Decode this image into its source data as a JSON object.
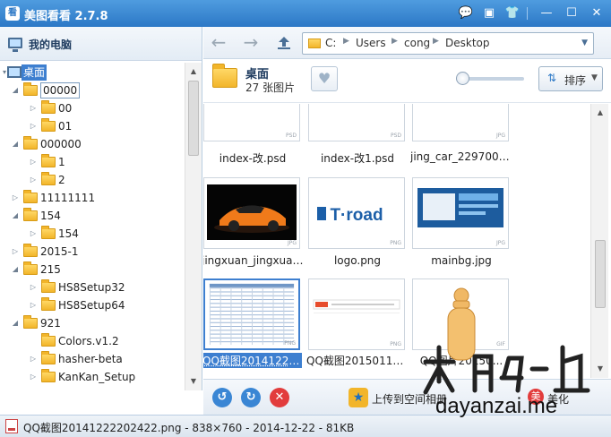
{
  "app": {
    "title": "美图看看 2.7.8",
    "icon_text": "看"
  },
  "titlebar_buttons": [
    {
      "name": "chat-icon",
      "glyph": "💬"
    },
    {
      "name": "menu-icon",
      "glyph": "▣"
    },
    {
      "name": "skin-icon",
      "glyph": "👕"
    },
    {
      "name": "minimize-icon",
      "glyph": "—"
    },
    {
      "name": "maximize-icon",
      "glyph": "☐"
    },
    {
      "name": "close-icon",
      "glyph": "✕"
    }
  ],
  "sidebar": {
    "root_label": "我的电脑",
    "tree": [
      {
        "label": "桌面",
        "depth": 0,
        "type": "desktop",
        "arrow": "▾",
        "selected": true
      },
      {
        "label": "00000",
        "depth": 1,
        "arrow": "◢",
        "boxed": true
      },
      {
        "label": "00",
        "depth": 2,
        "arrow": "▷"
      },
      {
        "label": "01",
        "depth": 2,
        "arrow": "▷"
      },
      {
        "label": "000000",
        "depth": 1,
        "arrow": "◢"
      },
      {
        "label": "1",
        "depth": 2,
        "arrow": "▷"
      },
      {
        "label": "2",
        "depth": 2,
        "arrow": "▷"
      },
      {
        "label": "11111111",
        "depth": 1,
        "arrow": "▷"
      },
      {
        "label": "154",
        "depth": 1,
        "arrow": "◢"
      },
      {
        "label": "154",
        "depth": 2,
        "arrow": "▷"
      },
      {
        "label": "2015-1",
        "depth": 1,
        "arrow": "▷"
      },
      {
        "label": "215",
        "depth": 1,
        "arrow": "◢"
      },
      {
        "label": "HS8Setup32",
        "depth": 2,
        "arrow": "▷"
      },
      {
        "label": "HS8Setup64",
        "depth": 2,
        "arrow": "▷"
      },
      {
        "label": "921",
        "depth": 1,
        "arrow": "◢"
      },
      {
        "label": "Colors.v1.2",
        "depth": 2,
        "arrow": ""
      },
      {
        "label": "hasher-beta",
        "depth": 2,
        "arrow": "▷"
      },
      {
        "label": "KanKan_Setup",
        "depth": 2,
        "arrow": "▷"
      }
    ]
  },
  "address": {
    "segments": [
      "C:",
      "Users",
      "cong",
      "Desktop"
    ]
  },
  "folder_info": {
    "name": "桌面",
    "count": "27 张图片"
  },
  "sort": {
    "label": "排序"
  },
  "thumbnails": [
    {
      "caption": "index-改.psd",
      "tag": "PSD",
      "kind": "web1",
      "selected": false
    },
    {
      "caption": "index-改1.psd",
      "tag": "PSD",
      "kind": "web2",
      "selected": false
    },
    {
      "caption": "jing_car_229700_...",
      "tag": "JPG",
      "kind": "car-blue",
      "selected": false
    },
    {
      "caption": "jingxuan_jingxuan...",
      "tag": "JPG",
      "kind": "car-orange",
      "selected": false
    },
    {
      "caption": "logo.png",
      "tag": "PNG",
      "kind": "logo",
      "selected": false,
      "logo_text": "T·road"
    },
    {
      "caption": "mainbg.jpg",
      "tag": "JPG",
      "kind": "mainbg",
      "selected": false
    },
    {
      "caption": "QQ截图20141222...",
      "tag": "PNG",
      "kind": "table",
      "selected": true
    },
    {
      "caption": "QQ截图20150117...",
      "tag": "PNG",
      "kind": "web3",
      "selected": false
    },
    {
      "caption": "QQ图片20150...",
      "tag": "GIF",
      "kind": "gif",
      "selected": false
    }
  ],
  "actions": {
    "upload_label": "上传到空间相册",
    "beauty_label": "美化"
  },
  "status": {
    "text": "QQ截图20141222202422.png - 838×760 - 2014-12-22 - 81KB"
  },
  "watermark": {
    "text": "dayanzai.me"
  }
}
